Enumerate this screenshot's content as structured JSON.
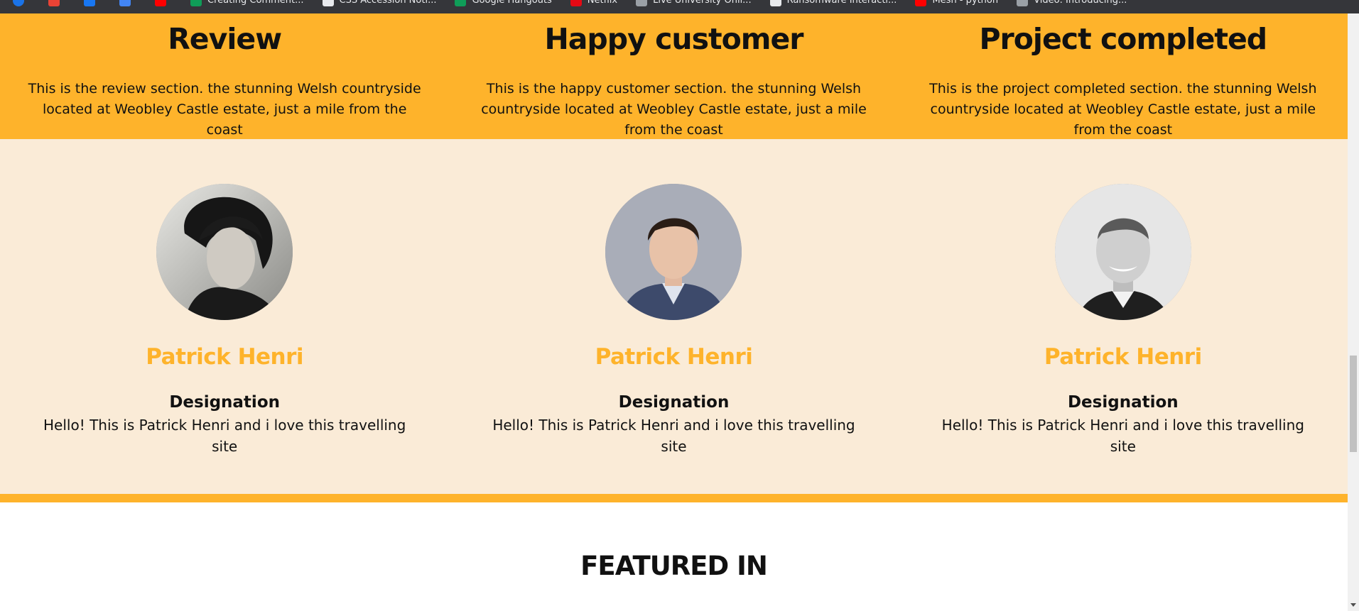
{
  "bookmarks": [
    {
      "label": "",
      "icon": "chrome-icon",
      "color": "#1a73e8"
    },
    {
      "label": "",
      "icon": "gmail-icon",
      "color": "#ea4335"
    },
    {
      "label": "",
      "icon": "facebook-icon",
      "color": "#1877f2"
    },
    {
      "label": "",
      "icon": "doc-icon",
      "color": "#4285f4"
    },
    {
      "label": "",
      "icon": "youtube-icon",
      "color": "#ff0000"
    },
    {
      "label": "Creating Comment...",
      "icon": "comment-icon",
      "color": "#0f9d58"
    },
    {
      "label": "CSS Accession Noti...",
      "icon": "page-icon",
      "color": "#e8eaed"
    },
    {
      "label": "Google Hangouts",
      "icon": "hangouts-icon",
      "color": "#0f9d58"
    },
    {
      "label": "Netflix",
      "icon": "netflix-icon",
      "color": "#e50914"
    },
    {
      "label": "Live University Onli...",
      "icon": "link-icon",
      "color": "#9aa0a6"
    },
    {
      "label": "Ransomware Interacti...",
      "icon": "page-icon",
      "color": "#e8eaed"
    },
    {
      "label": "Mesh - python",
      "icon": "youtube-icon",
      "color": "#ff0000"
    },
    {
      "label": "Video: Introducing...",
      "icon": "link-icon",
      "color": "#9aa0a6"
    }
  ],
  "stats": [
    {
      "title": "Review",
      "text": "This is the review section. the stunning Welsh countryside located at Weobley Castle estate, just a mile from the coast"
    },
    {
      "title": "Happy customer",
      "text": "This is the happy customer section. the stunning Welsh countryside located at Weobley Castle estate, just a mile from the coast"
    },
    {
      "title": "Project completed",
      "text": "This is the project completed section. the stunning Welsh countryside located at Weobley Castle estate, just a mile from the coast"
    }
  ],
  "testimonials": [
    {
      "name": "Patrick Henri",
      "designation": "Designation",
      "bio": "Hello! This is Patrick Henri and i love this travelling site"
    },
    {
      "name": "Patrick Henri",
      "designation": "Designation",
      "bio": "Hello! This is Patrick Henri and i love this travelling site"
    },
    {
      "name": "Patrick Henri",
      "designation": "Designation",
      "bio": "Hello! This is Patrick Henri and i love this travelling site"
    }
  ],
  "featured": {
    "title": "FEATURED IN"
  },
  "colors": {
    "accent": "#feb32b",
    "cream": "#faebd7"
  }
}
